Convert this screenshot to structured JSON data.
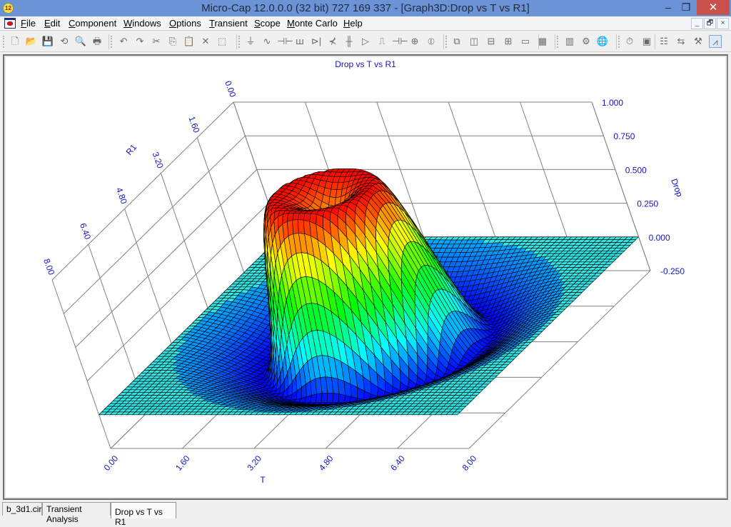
{
  "window": {
    "app_icon_label": "12",
    "title": "Micro-Cap 12.0.0.0 (32 bit) 727 169 337 - [Graph3D:Drop vs T vs R1]",
    "minimize_glyph": "–",
    "maximize_glyph": "❐",
    "close_glyph": "✕"
  },
  "menubar": {
    "items": [
      {
        "label": "File",
        "hotkey": "F"
      },
      {
        "label": "Edit",
        "hotkey": "E"
      },
      {
        "label": "Component",
        "hotkey": "C"
      },
      {
        "label": "Windows",
        "hotkey": "W"
      },
      {
        "label": "Options",
        "hotkey": "O"
      },
      {
        "label": "Transient",
        "hotkey": "T"
      },
      {
        "label": "Scope",
        "hotkey": "S"
      },
      {
        "label": "Monte Carlo",
        "hotkey": "M"
      },
      {
        "label": "Help",
        "hotkey": "H"
      }
    ],
    "mdi_buttons": [
      "_",
      "🗗",
      "×"
    ]
  },
  "toolbar": {
    "file_group": [
      {
        "name": "new-icon",
        "glyph": "🗋"
      },
      {
        "name": "open-icon",
        "glyph": "📂"
      },
      {
        "name": "save-icon",
        "glyph": "💾"
      },
      {
        "name": "revert-icon",
        "glyph": "⟲"
      },
      {
        "name": "print-preview-icon",
        "glyph": "🔍"
      },
      {
        "name": "print-icon",
        "glyph": "🖶"
      }
    ],
    "edit_group": [
      {
        "name": "undo-icon",
        "glyph": "↶"
      },
      {
        "name": "redo-icon",
        "glyph": "↷"
      },
      {
        "name": "cut-icon",
        "glyph": "✂"
      },
      {
        "name": "copy-icon",
        "glyph": "⎘"
      },
      {
        "name": "paste-icon",
        "glyph": "📋"
      },
      {
        "name": "clear-icon",
        "glyph": "✕"
      },
      {
        "name": "select-all-icon",
        "glyph": "⬚"
      }
    ],
    "component_group": [
      {
        "name": "ground-icon",
        "glyph": "⏚"
      },
      {
        "name": "resistor-icon",
        "glyph": "∿"
      },
      {
        "name": "capacitor-icon",
        "glyph": "⊣⊢"
      },
      {
        "name": "inductor-icon",
        "glyph": "ꟺ"
      },
      {
        "name": "diode-icon",
        "glyph": "⊳|"
      },
      {
        "name": "transistor-icon",
        "glyph": "⊀"
      },
      {
        "name": "mosfet-icon",
        "glyph": "╫"
      },
      {
        "name": "opamp-icon",
        "glyph": "▷"
      },
      {
        "name": "pulse-source-icon",
        "glyph": "⎍"
      },
      {
        "name": "battery-icon",
        "glyph": "⊣⊢"
      },
      {
        "name": "current-source-icon",
        "glyph": "⊕"
      },
      {
        "name": "voltage-source-icon",
        "glyph": "⦶"
      }
    ],
    "window_group": [
      {
        "name": "cascade-icon",
        "glyph": "⧉"
      },
      {
        "name": "tile-vertical-icon",
        "glyph": "◫"
      },
      {
        "name": "tile-horizontal-icon",
        "glyph": "⊟"
      },
      {
        "name": "split-icon",
        "glyph": "⊞"
      },
      {
        "name": "maximize-window-icon",
        "glyph": "▭"
      },
      {
        "name": "calculator-icon",
        "glyph": "▦"
      }
    ],
    "tools_group": [
      {
        "name": "properties-icon",
        "glyph": "▥"
      },
      {
        "name": "user-settings-icon",
        "glyph": "⚙"
      },
      {
        "name": "global-settings-icon",
        "glyph": "🌐"
      }
    ],
    "analysis_group": [
      {
        "name": "run-icon",
        "glyph": "⏱"
      },
      {
        "name": "state-variables-icon",
        "glyph": "▣"
      },
      {
        "name": "analysis-limits-icon",
        "glyph": "☷"
      },
      {
        "name": "stepping-icon",
        "glyph": "⇆"
      },
      {
        "name": "tools-icon",
        "glyph": "⚒"
      },
      {
        "name": "plot-icon",
        "glyph": "⩘"
      }
    ]
  },
  "tabs": [
    {
      "label": "b_3d1.cir",
      "active": false
    },
    {
      "label": "Transient Analysis",
      "active": false
    },
    {
      "label": "Drop vs T vs R1",
      "active": true
    }
  ],
  "chart_data": {
    "type": "surface3d",
    "title": "Drop vs T vs R1",
    "x_axis": {
      "label": "T",
      "range": [
        0,
        8
      ],
      "ticks": [
        "0.00",
        "1.60",
        "3.20",
        "4.80",
        "6.40",
        "8.00"
      ]
    },
    "y_axis": {
      "label": "R1",
      "range": [
        0,
        8
      ],
      "ticks": [
        "0.00",
        "1.60",
        "3.20",
        "4.80",
        "6.40",
        "8.00"
      ]
    },
    "z_axis": {
      "label": "Drop",
      "range": [
        -0.25,
        1.0
      ],
      "ticks": [
        "-0.250",
        "0.000",
        "0.250",
        "0.500",
        "0.750",
        "1.000"
      ]
    },
    "surface": {
      "description": "Radially symmetric ripple centered at T=4, R1=4: central crater with rim reaching ~1.0 near radius 1, negative trough ~-0.2 near radius 2.3, small secondary ring, flat 0 beyond radius ~3.8",
      "center": [
        4,
        4
      ],
      "peak_value": 1.0,
      "peak_radius": 1.0,
      "center_value": 0.75,
      "trough_value": -0.2,
      "trough_radius": 2.3,
      "outer_value": 0.0,
      "grid_points": 64
    },
    "colormap": [
      "#0000ff",
      "#00ffff",
      "#00ff00",
      "#ffff00",
      "#ff0000"
    ],
    "flat_color": "#33e6e6",
    "grid": true
  }
}
